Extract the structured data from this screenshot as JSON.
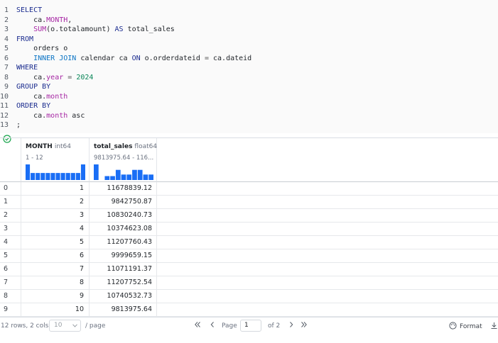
{
  "editor": {
    "lines": [
      {
        "n": "1",
        "tokens": [
          {
            "t": "kw",
            "v": "SELECT"
          }
        ]
      },
      {
        "n": "2",
        "tokens": [
          {
            "t": "plain",
            "v": "    ca."
          },
          {
            "t": "fn",
            "v": "MONTH"
          },
          {
            "t": "plain",
            "v": ","
          }
        ]
      },
      {
        "n": "3",
        "tokens": [
          {
            "t": "plain",
            "v": "    "
          },
          {
            "t": "fn",
            "v": "SUM"
          },
          {
            "t": "plain",
            "v": "(o.totalamount) "
          },
          {
            "t": "kw",
            "v": "AS"
          },
          {
            "t": "plain",
            "v": " total_sales"
          }
        ]
      },
      {
        "n": "4",
        "tokens": [
          {
            "t": "kw",
            "v": "FROM"
          }
        ]
      },
      {
        "n": "5",
        "tokens": [
          {
            "t": "plain",
            "v": "    orders o"
          }
        ]
      },
      {
        "n": "6",
        "tokens": [
          {
            "t": "plain",
            "v": "    "
          },
          {
            "t": "id",
            "v": "INNER JOIN"
          },
          {
            "t": "plain",
            "v": " calendar ca "
          },
          {
            "t": "kw",
            "v": "ON"
          },
          {
            "t": "plain",
            "v": " o.orderdateid "
          },
          {
            "t": "op",
            "v": "="
          },
          {
            "t": "plain",
            "v": " ca.dateid"
          }
        ]
      },
      {
        "n": "7",
        "tokens": [
          {
            "t": "kw",
            "v": "WHERE"
          }
        ]
      },
      {
        "n": "8",
        "tokens": [
          {
            "t": "plain",
            "v": "    ca."
          },
          {
            "t": "fn",
            "v": "year"
          },
          {
            "t": "plain",
            "v": " "
          },
          {
            "t": "op",
            "v": "="
          },
          {
            "t": "plain",
            "v": " "
          },
          {
            "t": "num",
            "v": "2024"
          }
        ]
      },
      {
        "n": "9",
        "tokens": [
          {
            "t": "kw",
            "v": "GROUP BY"
          }
        ]
      },
      {
        "n": "10",
        "tokens": [
          {
            "t": "plain",
            "v": "    ca."
          },
          {
            "t": "fn",
            "v": "month"
          }
        ]
      },
      {
        "n": "11",
        "tokens": [
          {
            "t": "kw",
            "v": "ORDER BY"
          }
        ]
      },
      {
        "n": "12",
        "tokens": [
          {
            "t": "plain",
            "v": "    ca."
          },
          {
            "t": "fn",
            "v": "month"
          },
          {
            "t": "plain",
            "v": " asc"
          }
        ]
      },
      {
        "n": "13",
        "tokens": [
          {
            "t": "plain",
            "v": ";"
          }
        ]
      }
    ]
  },
  "results": {
    "columns": [
      {
        "name": "MONTH",
        "type": "int64",
        "range": "1 - 12",
        "hist": [
          1,
          0.45,
          0.45,
          0.45,
          0.45,
          0.45,
          0.45,
          0.45,
          0.45,
          0.45,
          0.45,
          1
        ]
      },
      {
        "name": "total_sales",
        "type": "float64",
        "range": "9813975.64 - 116...",
        "hist": [
          1,
          0,
          0.25,
          0.25,
          0.65,
          0.35,
          0.35,
          0.65,
          0.65,
          0.35,
          0.35
        ]
      }
    ],
    "rows": [
      {
        "idx": "0",
        "month": "1",
        "sales": "11678839.12"
      },
      {
        "idx": "1",
        "month": "2",
        "sales": "9842750.87"
      },
      {
        "idx": "2",
        "month": "3",
        "sales": "10830240.73"
      },
      {
        "idx": "3",
        "month": "4",
        "sales": "10374623.08"
      },
      {
        "idx": "4",
        "month": "5",
        "sales": "11207760.43"
      },
      {
        "idx": "5",
        "month": "6",
        "sales": "9999659.15"
      },
      {
        "idx": "6",
        "month": "7",
        "sales": "11071191.37"
      },
      {
        "idx": "7",
        "month": "8",
        "sales": "11207752.54"
      },
      {
        "idx": "8",
        "month": "9",
        "sales": "10740532.73"
      },
      {
        "idx": "9",
        "month": "10",
        "sales": "9813975.64"
      }
    ]
  },
  "footer": {
    "rows_info": "12 rows, 2 cols",
    "page_size": "10",
    "per_page": "/ page",
    "page_label": "Page",
    "page_value": "1",
    "of_label": "of 2",
    "format_label": "Format",
    "first_icon": "double-chevron-left-icon",
    "prev_icon": "chevron-left-icon",
    "next_icon": "chevron-right-icon",
    "last_icon": "double-chevron-right-icon"
  },
  "colors": {
    "hist_bar": "#1a6ef5",
    "success": "#16a34a"
  }
}
